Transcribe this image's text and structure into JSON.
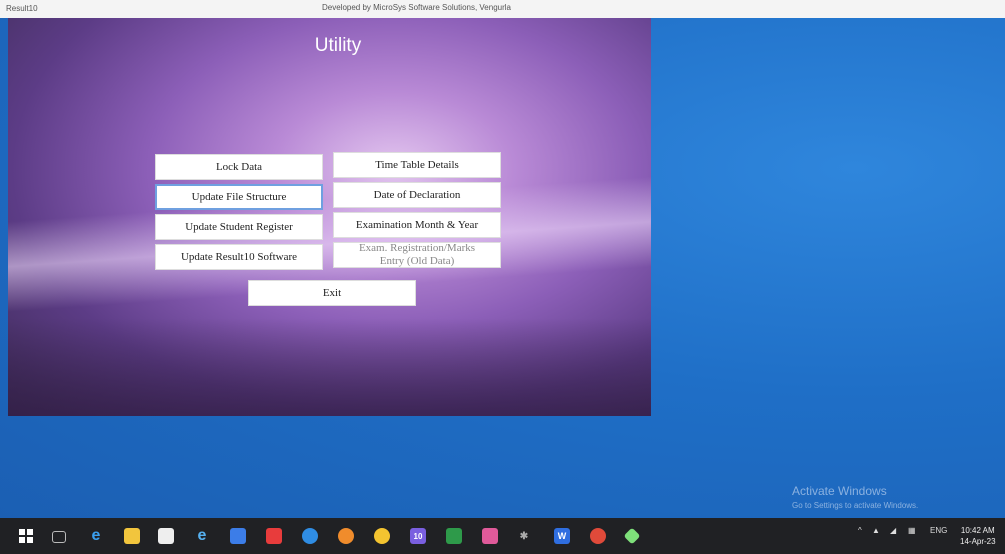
{
  "window": {
    "app_name": "Result10",
    "credit": "Developed by MicroSys Software Solutions, Vengurla"
  },
  "utility": {
    "title": "Utility",
    "buttons": {
      "lock_data": "Lock Data",
      "time_table": "Time Table Details",
      "update_file_structure": "Update File Structure",
      "date_of_declaration": "Date of Declaration",
      "update_student_register": "Update Student Register",
      "exam_month_year": "Examination Month & Year",
      "update_software": "Update Result10 Software",
      "exam_registration_line1": "Exam. Registration/Marks",
      "exam_registration_line2": "Entry (Old Data)",
      "exit": "Exit"
    }
  },
  "desktop": {
    "activate_title": "Activate Windows",
    "activate_subtitle": "Go to Settings to activate Windows."
  },
  "taskbar": {
    "icons": [
      "windows-start-icon",
      "task-view-icon",
      "edge-icon",
      "file-explorer-icon",
      "store-icon",
      "ie-icon",
      "photos-icon",
      "media-icon",
      "chat-icon",
      "firefox-icon",
      "chrome-icon",
      "notes-icon",
      "excel-icon",
      "paint-icon",
      "settings-icon",
      "word-icon",
      "maps-icon",
      "app-icon"
    ],
    "tray_language": "ENG",
    "time": "10:42 AM",
    "date": "14-Apr-23"
  },
  "colors": {
    "desktop_blue": "#1f6fc7",
    "panel_purple": "#8c5fb8",
    "taskbar": "#202124"
  }
}
